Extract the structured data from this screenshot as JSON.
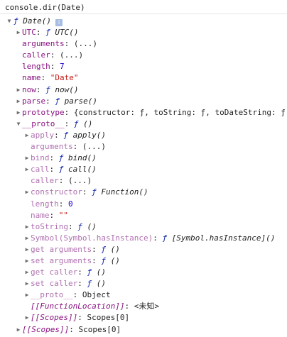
{
  "console": {
    "command": "console.dir(Date)"
  },
  "tree": [
    {
      "depth": 0,
      "arrow": "down",
      "name": "",
      "sep": "",
      "value": {
        "fn": "ƒ",
        "sig": "Date()"
      },
      "info_icon": true
    },
    {
      "depth": 1,
      "arrow": "right",
      "name": "UTC",
      "sep": ": ",
      "value": {
        "fn": "ƒ",
        "sig": "UTC()"
      }
    },
    {
      "depth": 1,
      "arrow": "none",
      "name": "arguments",
      "sep": ": ",
      "value": {
        "text": "(...)"
      }
    },
    {
      "depth": 1,
      "arrow": "none",
      "name": "caller",
      "sep": ": ",
      "value": {
        "text": "(...)"
      }
    },
    {
      "depth": 1,
      "arrow": "none",
      "name": "length",
      "sep": ": ",
      "value": {
        "number": "7"
      }
    },
    {
      "depth": 1,
      "arrow": "none",
      "name": "name",
      "sep": ": ",
      "value": {
        "string": "\"Date\""
      }
    },
    {
      "depth": 1,
      "arrow": "right",
      "name": "now",
      "sep": ": ",
      "value": {
        "fn": "ƒ",
        "sig": "now()"
      }
    },
    {
      "depth": 1,
      "arrow": "right",
      "name": "parse",
      "sep": ": ",
      "value": {
        "fn": "ƒ",
        "sig": "parse()"
      }
    },
    {
      "depth": 1,
      "arrow": "right",
      "name": "prototype",
      "sep": ": ",
      "value": {
        "text": "{constructor: ƒ, toString: ƒ, toDateString: ƒ,"
      }
    },
    {
      "depth": 1,
      "arrow": "down",
      "name": "__proto__",
      "sep": ": ",
      "value": {
        "fn": "ƒ",
        "sig": "()"
      }
    },
    {
      "depth": 2,
      "arrow": "right",
      "name": "apply",
      "sep": ": ",
      "value": {
        "fn": "ƒ",
        "sig": "apply()"
      }
    },
    {
      "depth": 2,
      "arrow": "none",
      "name": "arguments",
      "sep": ": ",
      "value": {
        "text": "(...)"
      }
    },
    {
      "depth": 2,
      "arrow": "right",
      "name": "bind",
      "sep": ": ",
      "value": {
        "fn": "ƒ",
        "sig": "bind()"
      }
    },
    {
      "depth": 2,
      "arrow": "right",
      "name": "call",
      "sep": ": ",
      "value": {
        "fn": "ƒ",
        "sig": "call()"
      }
    },
    {
      "depth": 2,
      "arrow": "none",
      "name": "caller",
      "sep": ": ",
      "value": {
        "text": "(...)"
      }
    },
    {
      "depth": 2,
      "arrow": "right",
      "name": "constructor",
      "sep": ": ",
      "value": {
        "fn": "ƒ",
        "sig": "Function()"
      }
    },
    {
      "depth": 2,
      "arrow": "none",
      "name": "length",
      "sep": ": ",
      "value": {
        "number": "0"
      }
    },
    {
      "depth": 2,
      "arrow": "none",
      "name": "name",
      "sep": ": ",
      "value": {
        "string": "\"\""
      }
    },
    {
      "depth": 2,
      "arrow": "right",
      "name": "toString",
      "sep": ": ",
      "value": {
        "fn": "ƒ",
        "sig": "()"
      }
    },
    {
      "depth": 2,
      "arrow": "right",
      "name": "Symbol(Symbol.hasInstance)",
      "sep": ": ",
      "value": {
        "fn": "ƒ",
        "sig": "[Symbol.hasInstance]()"
      }
    },
    {
      "depth": 2,
      "arrow": "right",
      "name": "get arguments",
      "sep": ": ",
      "value": {
        "fn": "ƒ",
        "sig": "()"
      }
    },
    {
      "depth": 2,
      "arrow": "right",
      "name": "set arguments",
      "sep": ": ",
      "value": {
        "fn": "ƒ",
        "sig": "()"
      }
    },
    {
      "depth": 2,
      "arrow": "right",
      "name": "get caller",
      "sep": ": ",
      "value": {
        "fn": "ƒ",
        "sig": "()"
      }
    },
    {
      "depth": 2,
      "arrow": "right",
      "name": "set caller",
      "sep": ": ",
      "value": {
        "fn": "ƒ",
        "sig": "()"
      }
    },
    {
      "depth": 2,
      "arrow": "right",
      "name": "__proto__",
      "sep": ": ",
      "value": {
        "text": "Object"
      }
    },
    {
      "depth": 2,
      "arrow": "none",
      "name": "[[FunctionLocation]]",
      "internal": true,
      "sep": ": ",
      "value": {
        "text": "<未知>"
      }
    },
    {
      "depth": 2,
      "arrow": "right",
      "name": "[[Scopes]]",
      "internal": true,
      "sep": ": ",
      "value": {
        "text": "Scopes[0]"
      }
    },
    {
      "depth": 1,
      "arrow": "right",
      "name": "[[Scopes]]",
      "internal": true,
      "sep": ": ",
      "value": {
        "text": "Scopes[0]"
      }
    }
  ],
  "icons": {
    "expanded": "triangle-down-icon",
    "collapsed": "triangle-right-icon",
    "info": "info-icon"
  },
  "colors": {
    "key": "#881280",
    "key_inherited": "#b071b0",
    "function_keyword": "#0d22aa",
    "number": "#1c00cf",
    "string": "#c41a16",
    "text": "#222222"
  }
}
